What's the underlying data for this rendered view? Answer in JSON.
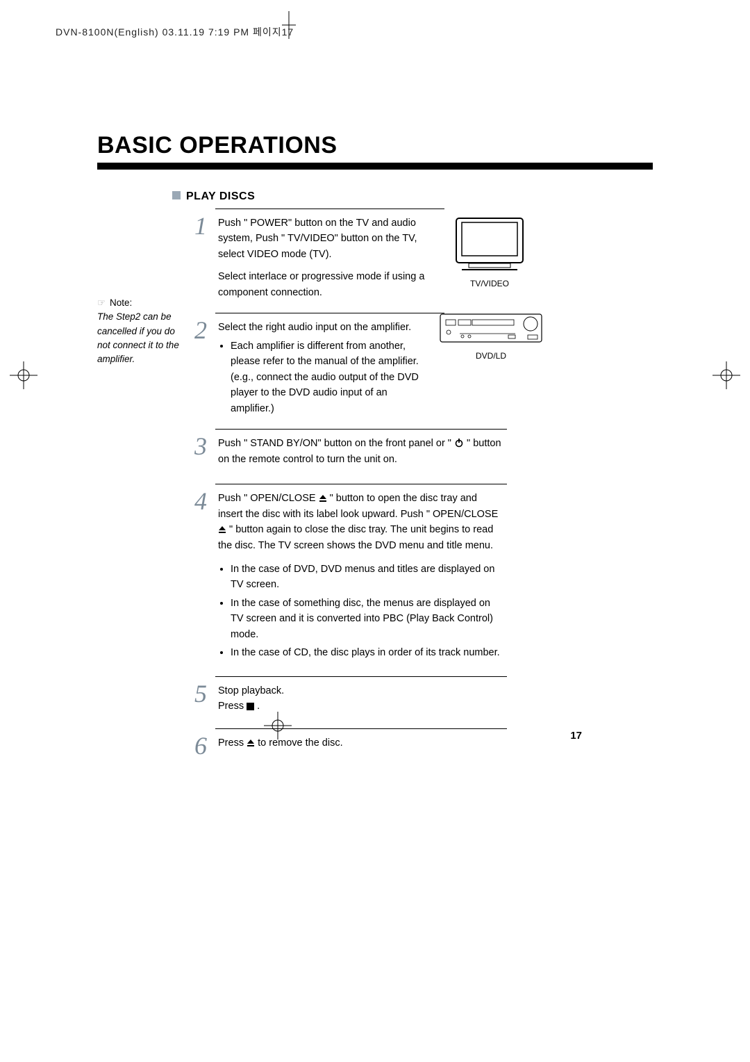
{
  "header": "DVN-8100N(English)  03.11.19  7:19 PM  페이지17",
  "title": "BASIC OPERATIONS",
  "section": "PLAY DISCS",
  "note": {
    "label": "Note:",
    "body": "The Step2 can be cancelled if you do not connect it to the amplifier."
  },
  "tv_caption": "TV/VIDEO",
  "amp_caption": "DVD/LD",
  "steps": [
    {
      "num": "1",
      "para1": "Push \" POWER\"  button on the TV and audio system, Push \" TV/VIDEO\"  button on the TV, select VIDEO mode (TV).",
      "para2": "Select  interlace or progressive mode if using a component connection."
    },
    {
      "num": "2",
      "para1": "Select the right audio input on the amplifier.",
      "bullets": [
        "Each amplifier is different from another, please refer to the manual of the amplifier. (e.g., connect the audio output of the DVD player to the DVD audio input of an amplifier.)"
      ]
    },
    {
      "num": "3",
      "para1_a": "Push \" STAND BY/ON\"  button on the front panel or \" ",
      "para1_b": " \"  button on the remote control to turn the unit on."
    },
    {
      "num": "4",
      "para1_a": "Push \" OPEN/CLOSE ",
      "para1_b": " \"  button to open the disc tray and insert the disc with its label look upward. Push \" OPEN/CLOSE ",
      "para1_c": " \"  button again to close the disc tray. The unit begins to read the disc. The TV screen shows the DVD menu and title menu.",
      "bullets": [
        "In the case of DVD, DVD menus and titles are displayed on TV screen.",
        "In the case of something disc, the menus are displayed on TV screen and it is converted into PBC (Play Back Control) mode.",
        "In the case of CD, the disc plays in order of its track number."
      ]
    },
    {
      "num": "5",
      "para1": "Stop playback.",
      "para2_a": "Press ",
      "para2_b": " ."
    },
    {
      "num": "6",
      "para1_a": "Press ",
      "para1_b": "  to remove the disc."
    }
  ],
  "page_number": "17"
}
